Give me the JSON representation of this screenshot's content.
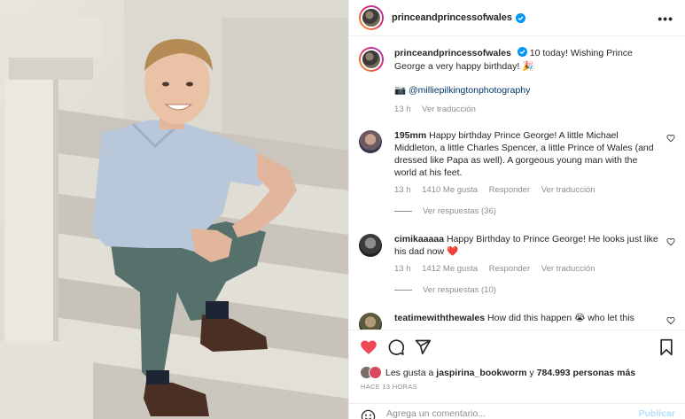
{
  "post": {
    "username": "princeandprincessofwales",
    "more_icon": "more-horizontal-icon"
  },
  "caption": {
    "username": "princeandprincessofwales",
    "text": "10 today! Wishing Prince George a very happy birthday! 🎉",
    "credit_emoji": "📷",
    "credit": "@milliepilkingtonphotography",
    "time": "13 h",
    "translate": "Ver traducción"
  },
  "comments": [
    {
      "username": "195mm",
      "text": "Happy birthday Prince George! A little Michael Middleton, a little Charles Spencer, a little Prince of Wales (and dressed like Papa as well). A gorgeous young man with the world at his feet.",
      "time": "13 h",
      "likes": "1410 Me gusta",
      "reply": "Responder",
      "translate": "Ver traducción",
      "view_replies": "Ver respuestas (36)"
    },
    {
      "username": "cimikaaaaa",
      "text": "Happy Birthday to Prince George! He looks just like his dad now",
      "emoji": "❤️",
      "time": "13 h",
      "likes": "1412 Me gusta",
      "reply": "Responder",
      "translate": "Ver traducción",
      "view_replies": "Ver respuestas (10)"
    },
    {
      "username": "teatimewiththewales",
      "text": "How did this happen 😭 who let this"
    }
  ],
  "liked_by": {
    "prefix": "Les gusta a",
    "user": "jaspirina_bookworm",
    "middle": "y",
    "count": "784.993 personas más"
  },
  "timestamp": "HACE 13 HORAS",
  "add_comment": {
    "placeholder": "Agrega un comentario...",
    "post_label": "Publicar"
  },
  "colors": {
    "accent_blue": "#0095f6",
    "like_red": "#ed4956",
    "muted": "#8e8e8e"
  }
}
